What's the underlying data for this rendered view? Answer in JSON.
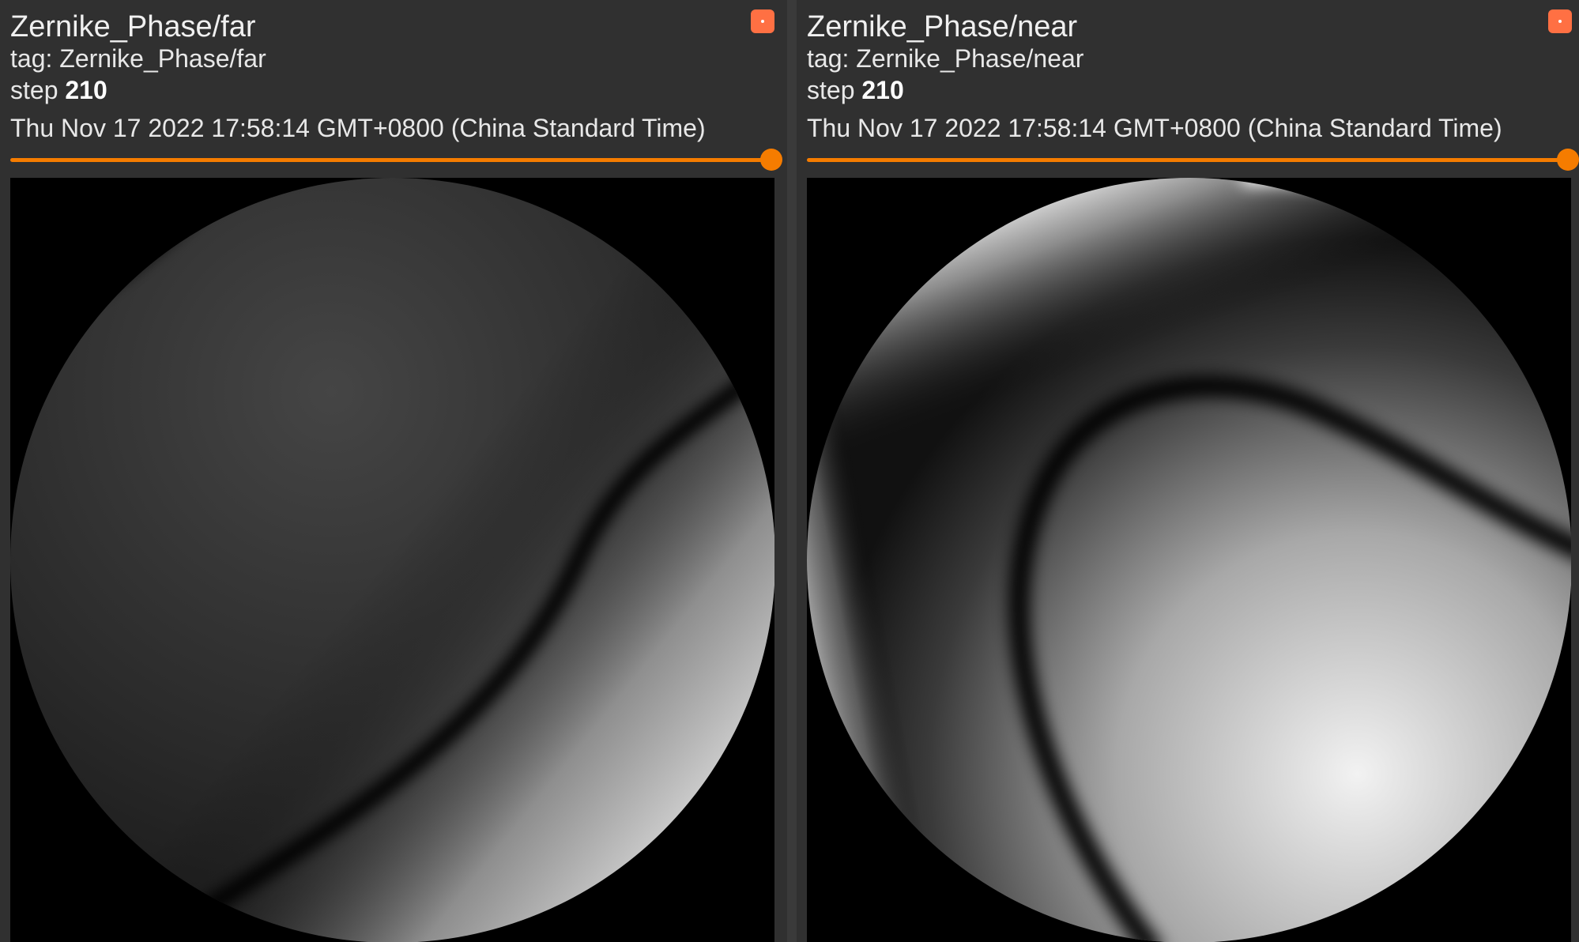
{
  "cards": [
    {
      "title": "Zernike_Phase/far",
      "tag_label": "tag: Zernike_Phase/far",
      "step_label": "step",
      "step_value": "210",
      "timestamp": "Thu Nov 17 2022 17:58:14 GMT+0800 (China Standard Time)",
      "image_kind": "grayscale-phase-disc"
    },
    {
      "title": "Zernike_Phase/near",
      "tag_label": "tag: Zernike_Phase/near",
      "step_label": "step",
      "step_value": "210",
      "timestamp": "Thu Nov 17 2022 17:58:14 GMT+0800 (China Standard Time)",
      "image_kind": "grayscale-phase-disc"
    }
  ],
  "colors": {
    "accent": "#f57c00",
    "menu_button": "#ff7043",
    "card_background": "#303030",
    "image_background": "#000000"
  },
  "slider": {
    "position_fraction": 1.0
  }
}
